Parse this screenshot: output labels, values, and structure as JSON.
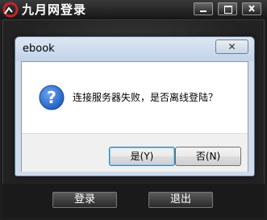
{
  "app": {
    "title": "九月网登录",
    "buttons": {
      "login_label": "登录",
      "exit_label": "退出"
    }
  },
  "dialog": {
    "title": "ebook",
    "close_label": "✕",
    "message": "连接服务器失败，是否离线登陆？",
    "icon": "question-icon",
    "buttons": {
      "yes_label": "是(Y)",
      "no_label": "否(N)"
    }
  },
  "colors": {
    "app_titlebar": "#161616",
    "dialog_frame": "#cfdcec",
    "accent_red": "#c0252b",
    "question_blue": "#1f5fbf"
  }
}
